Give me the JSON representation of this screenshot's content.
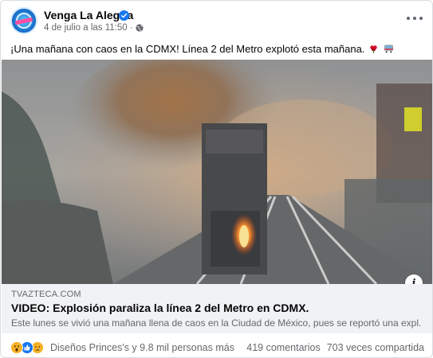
{
  "post": {
    "page_name": "Venga La Alegría",
    "date": "4 de julio a las 11:50 ·",
    "caption": "¡Una mañana con caos en la CDMX! Línea 2 del Metro explotó esta mañana.",
    "emojis": [
      "flower-icon",
      "train-icon"
    ]
  },
  "link_preview": {
    "domain": "TVAZTECA.COM",
    "title": "VIDEO: Explosión paraliza la línea 2 del Metro en CDMX.",
    "description": "Este lunes se vivió una mañana llena de caos en la Ciudad de México, pues se reportó una expl..."
  },
  "engagement": {
    "reactions": [
      "wow",
      "like",
      "sad"
    ],
    "likers": "Diseños Princes's y 9.8 mil personas más",
    "comments": "419 comentarios",
    "shares": "703 veces compartida"
  },
  "colors": {
    "accent": "#1877f2",
    "secondary_text": "#65676b",
    "link_box_bg": "#f0f2f5"
  }
}
